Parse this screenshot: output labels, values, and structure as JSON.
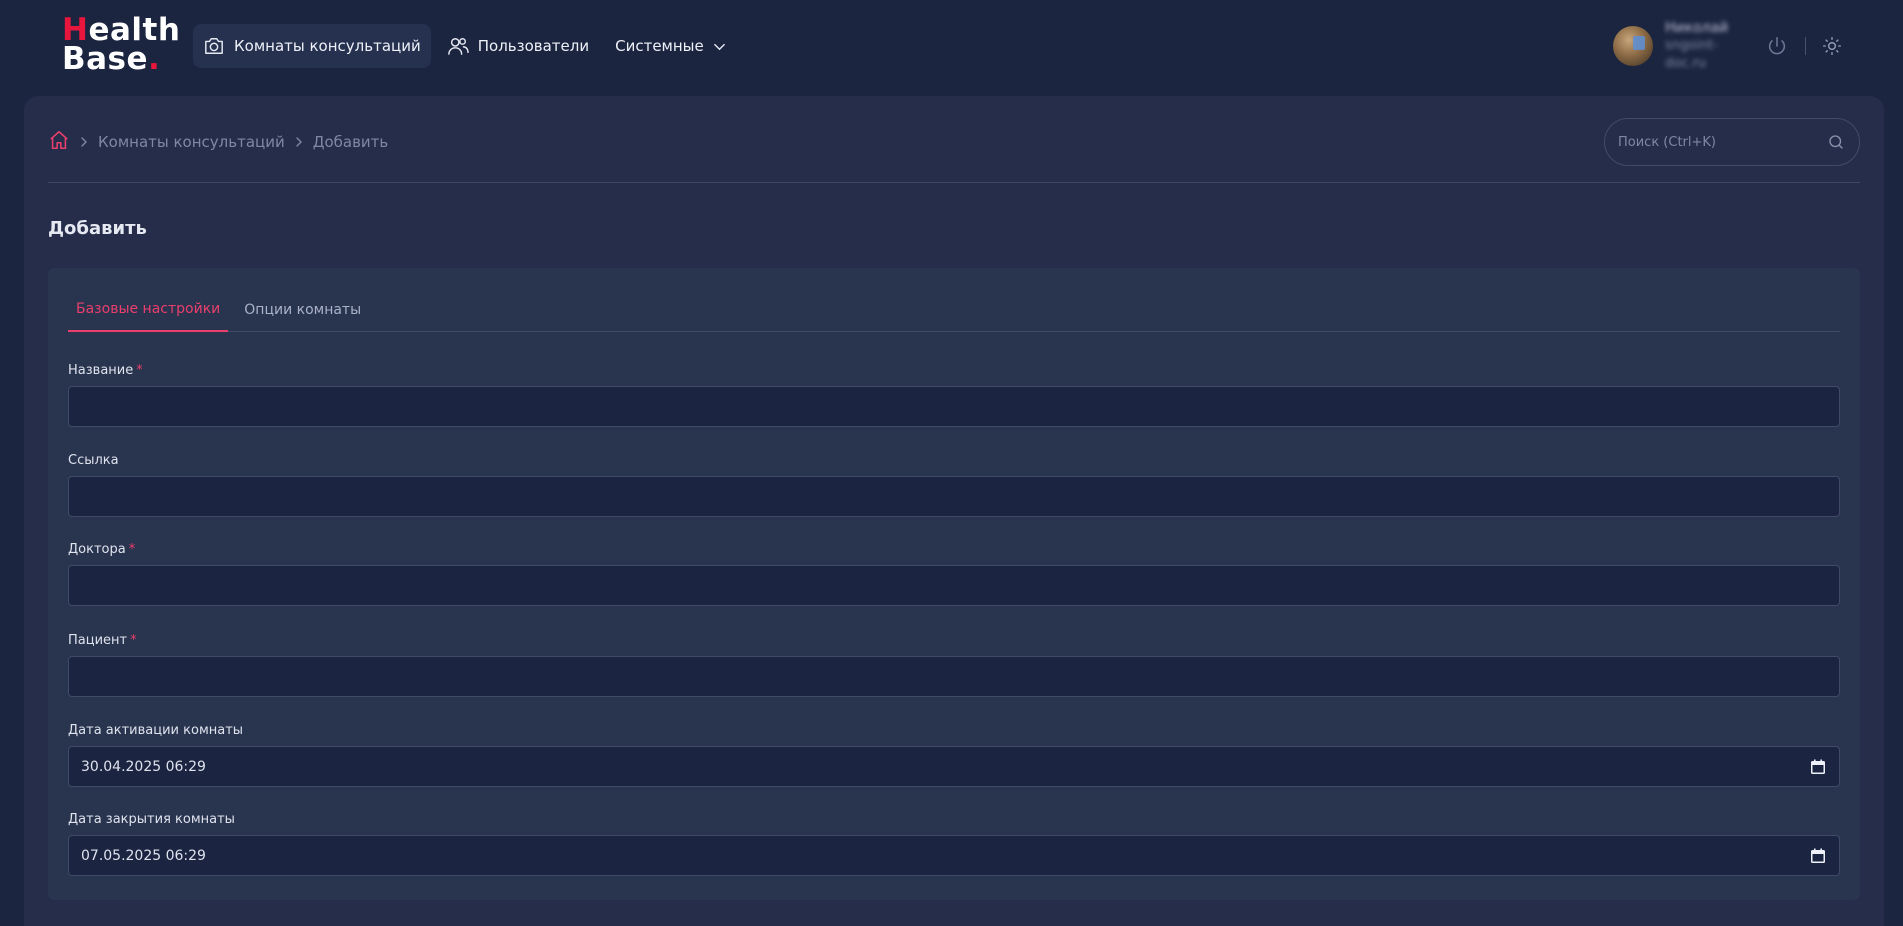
{
  "logo": {
    "line1_accent": "H",
    "line1_rest": "ealth",
    "line2": "Base",
    "line2_accent": "."
  },
  "nav": {
    "items": [
      {
        "label": "Комнаты консультаций",
        "icon": "camera-icon",
        "active": true
      },
      {
        "label": "Пользователи",
        "icon": "users-icon"
      },
      {
        "label": "Системные",
        "icon": "chevron-down-icon"
      }
    ]
  },
  "user": {
    "name": "Николай",
    "email": "sngoint-doc.ru"
  },
  "breadcrumb": {
    "home_icon": "home-icon",
    "items": [
      "Комнаты консультаций",
      "Добавить"
    ]
  },
  "search": {
    "placeholder": "Поиск (Ctrl+K)",
    "value": ""
  },
  "page": {
    "title": "Добавить"
  },
  "tabs": [
    {
      "label": "Базовые настройки",
      "active": true
    },
    {
      "label": "Опции комнаты"
    }
  ],
  "form": {
    "fields": [
      {
        "label": "Название",
        "required": true,
        "value": ""
      },
      {
        "label": "Ссылка",
        "required": false,
        "value": ""
      },
      {
        "label": "Доктора",
        "required": true,
        "value": ""
      },
      {
        "label": "Пациент",
        "required": true,
        "value": ""
      },
      {
        "label": "Дата активации комнаты",
        "required": false,
        "value": "30.04.2025 06:29"
      },
      {
        "label": "Дата закрытия комнаты",
        "required": false,
        "value": "07.05.2025 06:29"
      }
    ],
    "required_mark": "*"
  },
  "colors": {
    "accent": "#ea3f6c",
    "logo_red": "#e8163c",
    "background": "#1c2540",
    "panel": "#252d4a",
    "card": "#29344f",
    "input": "#1b2440"
  }
}
